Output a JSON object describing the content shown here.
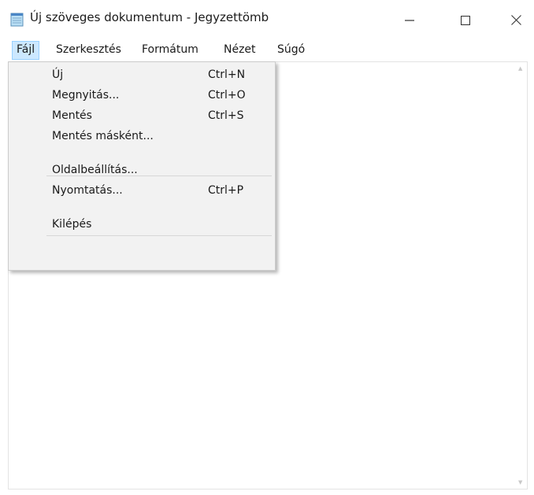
{
  "window": {
    "title": "Új szöveges dokumentum - Jegyzettömb",
    "icon": "notepad-icon",
    "controls": {
      "minimize_icon": "minimize-icon",
      "maximize_icon": "maximize-icon",
      "close_icon": "close-icon"
    }
  },
  "menubar": {
    "items": [
      {
        "label": "Fájl",
        "active": true
      },
      {
        "label": "Szerkesztés",
        "active": false
      },
      {
        "label": "Formátum",
        "active": false
      },
      {
        "label": "Nézet",
        "active": false
      },
      {
        "label": "Súgó",
        "active": false
      }
    ]
  },
  "file_menu": {
    "items": [
      {
        "label": "Új",
        "shortcut": "Ctrl+N"
      },
      {
        "label": "Megnyitás...",
        "shortcut": "Ctrl+O"
      },
      {
        "label": "Mentés",
        "shortcut": "Ctrl+S"
      },
      {
        "label": "Mentés másként...",
        "shortcut": ""
      },
      {
        "label": "Oldalbeállítás...",
        "shortcut": ""
      },
      {
        "label": "Nyomtatás...",
        "shortcut": "Ctrl+P"
      },
      {
        "label": "Kilépés",
        "shortcut": ""
      }
    ]
  },
  "editor": {
    "content": ""
  },
  "colors": {
    "menu_highlight": "#cce8ff",
    "menu_highlight_border": "#99d1ff",
    "dropdown_background": "#f2f2f2"
  }
}
